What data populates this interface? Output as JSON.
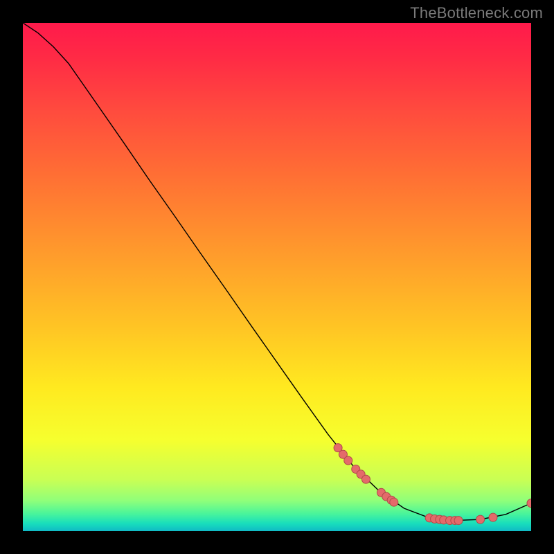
{
  "watermark": "TheBottleneck.com",
  "chart_data": {
    "type": "line",
    "title": "",
    "xlabel": "",
    "ylabel": "",
    "xlim": [
      0,
      100
    ],
    "ylim": [
      0,
      100
    ],
    "background_gradient": {
      "stops": [
        {
          "offset": 0.0,
          "color": "#ff1a4b"
        },
        {
          "offset": 0.07,
          "color": "#ff2b45"
        },
        {
          "offset": 0.17,
          "color": "#ff4a3e"
        },
        {
          "offset": 0.3,
          "color": "#ff6f34"
        },
        {
          "offset": 0.45,
          "color": "#ff9a2c"
        },
        {
          "offset": 0.6,
          "color": "#ffc524"
        },
        {
          "offset": 0.72,
          "color": "#ffea20"
        },
        {
          "offset": 0.82,
          "color": "#f6ff2e"
        },
        {
          "offset": 0.9,
          "color": "#c8ff55"
        },
        {
          "offset": 0.94,
          "color": "#90ff7a"
        },
        {
          "offset": 0.965,
          "color": "#4bf59a"
        },
        {
          "offset": 0.985,
          "color": "#18debc"
        },
        {
          "offset": 1.0,
          "color": "#10b9c5"
        }
      ]
    },
    "curve": [
      {
        "x": 0,
        "y": 100.0
      },
      {
        "x": 3,
        "y": 98.0
      },
      {
        "x": 6,
        "y": 95.3
      },
      {
        "x": 9,
        "y": 92.0
      },
      {
        "x": 12,
        "y": 87.7
      },
      {
        "x": 15,
        "y": 83.4
      },
      {
        "x": 20,
        "y": 76.2
      },
      {
        "x": 25,
        "y": 68.9
      },
      {
        "x": 30,
        "y": 61.8
      },
      {
        "x": 35,
        "y": 54.6
      },
      {
        "x": 40,
        "y": 47.5
      },
      {
        "x": 45,
        "y": 40.3
      },
      {
        "x": 50,
        "y": 33.2
      },
      {
        "x": 55,
        "y": 26.1
      },
      {
        "x": 60,
        "y": 19.1
      },
      {
        "x": 65,
        "y": 12.8
      },
      {
        "x": 70,
        "y": 8.0
      },
      {
        "x": 75,
        "y": 4.5
      },
      {
        "x": 80,
        "y": 2.6
      },
      {
        "x": 85,
        "y": 2.1
      },
      {
        "x": 90,
        "y": 2.3
      },
      {
        "x": 95,
        "y": 3.3
      },
      {
        "x": 100,
        "y": 5.5
      }
    ],
    "markers": [
      {
        "x": 62.0,
        "y": 16.4
      },
      {
        "x": 63.0,
        "y": 15.1
      },
      {
        "x": 64.0,
        "y": 13.9
      },
      {
        "x": 65.5,
        "y": 12.2
      },
      {
        "x": 66.5,
        "y": 11.2
      },
      {
        "x": 67.5,
        "y": 10.2
      },
      {
        "x": 70.5,
        "y": 7.6
      },
      {
        "x": 71.5,
        "y": 6.8
      },
      {
        "x": 72.5,
        "y": 6.1
      },
      {
        "x": 73.0,
        "y": 5.7
      },
      {
        "x": 80.0,
        "y": 2.6
      },
      {
        "x": 81.0,
        "y": 2.4
      },
      {
        "x": 82.0,
        "y": 2.3
      },
      {
        "x": 82.8,
        "y": 2.2
      },
      {
        "x": 84.0,
        "y": 2.1
      },
      {
        "x": 85.0,
        "y": 2.1
      },
      {
        "x": 85.7,
        "y": 2.1
      },
      {
        "x": 90.0,
        "y": 2.3
      },
      {
        "x": 92.5,
        "y": 2.7
      },
      {
        "x": 100.0,
        "y": 5.5
      }
    ],
    "marker_style": {
      "fill": "#e46a6a",
      "stroke": "#b04a4a",
      "r": 6
    },
    "curve_style": {
      "stroke": "#000000",
      "width": 1.4
    }
  }
}
